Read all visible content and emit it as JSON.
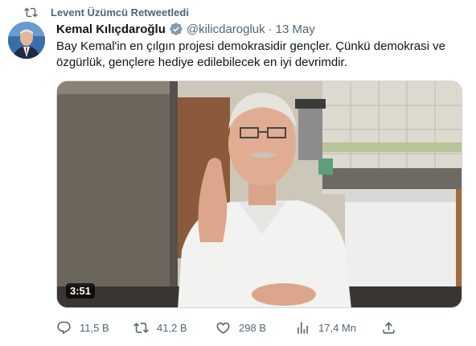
{
  "retweet_banner": {
    "text": "Levent Üzümcü Retweetledi"
  },
  "author": {
    "name": "Kemal Kılıçdaroğlu",
    "handle": "@kilicdarogluk",
    "separator": "·",
    "date": "13 May",
    "verified": true
  },
  "tweet_text": "Bay Kemal'in en çılgın projesi demokrasidir gençler. Çünkü demokrasi ve özgürlük, gençlere hediye edilebilecek en iyi devrimdir.",
  "video": {
    "duration": "3:51"
  },
  "actions": {
    "replies": "11,5 B",
    "retweets": "41,2 B",
    "likes": "298 B",
    "views": "17,4 Mn"
  },
  "colors": {
    "text_primary": "#0f1419",
    "text_secondary": "#536471",
    "verified": "#829aab"
  }
}
